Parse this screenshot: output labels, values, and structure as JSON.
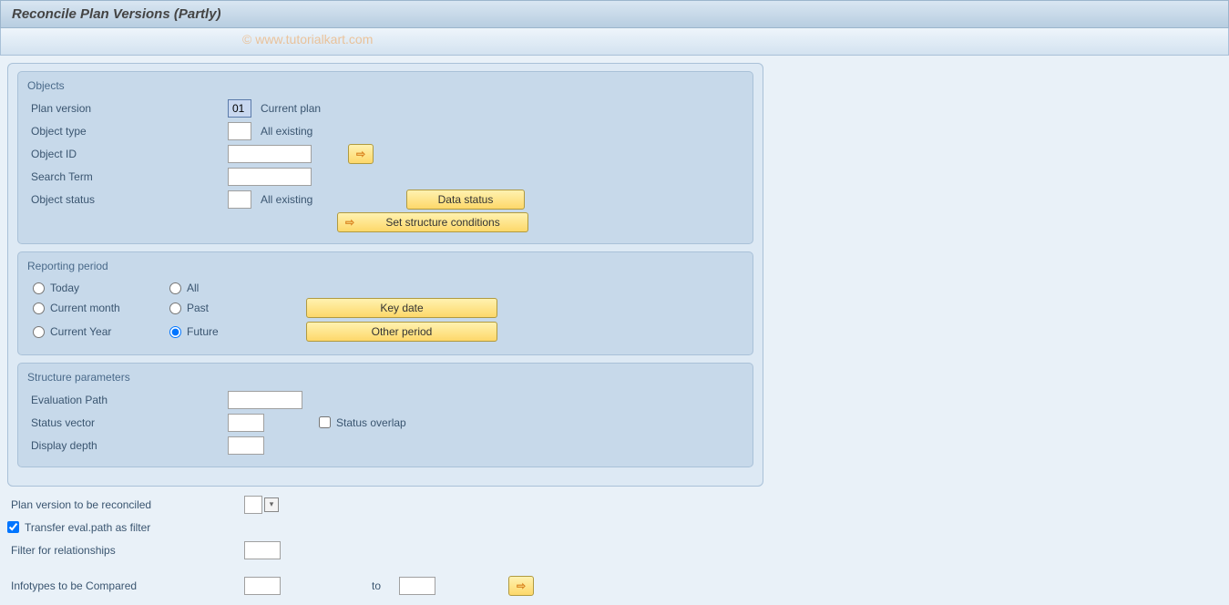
{
  "header": {
    "title": "Reconcile Plan Versions (Partly)"
  },
  "watermark": "© www.tutorialkart.com",
  "objects": {
    "title": "Objects",
    "plan_version": {
      "label": "Plan version",
      "value": "01",
      "desc": "Current plan"
    },
    "object_type": {
      "label": "Object type",
      "value": "",
      "desc": "All existing"
    },
    "object_id": {
      "label": "Object ID",
      "value": ""
    },
    "search_term": {
      "label": "Search Term",
      "value": ""
    },
    "object_status": {
      "label": "Object status",
      "value": "",
      "desc": "All existing"
    },
    "buttons": {
      "data_status": "Data status",
      "set_structure_conditions": "Set structure conditions"
    }
  },
  "reporting_period": {
    "title": "Reporting period",
    "radios": {
      "today": "Today",
      "current_month": "Current month",
      "current_year": "Current Year",
      "all": "All",
      "past": "Past",
      "future": "Future"
    },
    "selected": "future",
    "buttons": {
      "key_date": "Key date",
      "other_period": "Other period"
    }
  },
  "structure_parameters": {
    "title": "Structure parameters",
    "evaluation_path": {
      "label": "Evaluation Path",
      "value": ""
    },
    "status_vector": {
      "label": "Status vector",
      "value": ""
    },
    "status_overlap": {
      "label": "Status overlap",
      "checked": false
    },
    "display_depth": {
      "label": "Display depth",
      "value": ""
    }
  },
  "bottom": {
    "plan_version_reconciled": {
      "label": "Plan version to be reconciled",
      "value": ""
    },
    "transfer_eval_path": {
      "label": "Transfer eval.path as filter",
      "checked": true
    },
    "filter_relationships": {
      "label": "Filter for relationships",
      "value": ""
    },
    "infotypes_compared": {
      "label": "Infotypes to be Compared",
      "from": "",
      "to_label": "to",
      "to": ""
    }
  }
}
